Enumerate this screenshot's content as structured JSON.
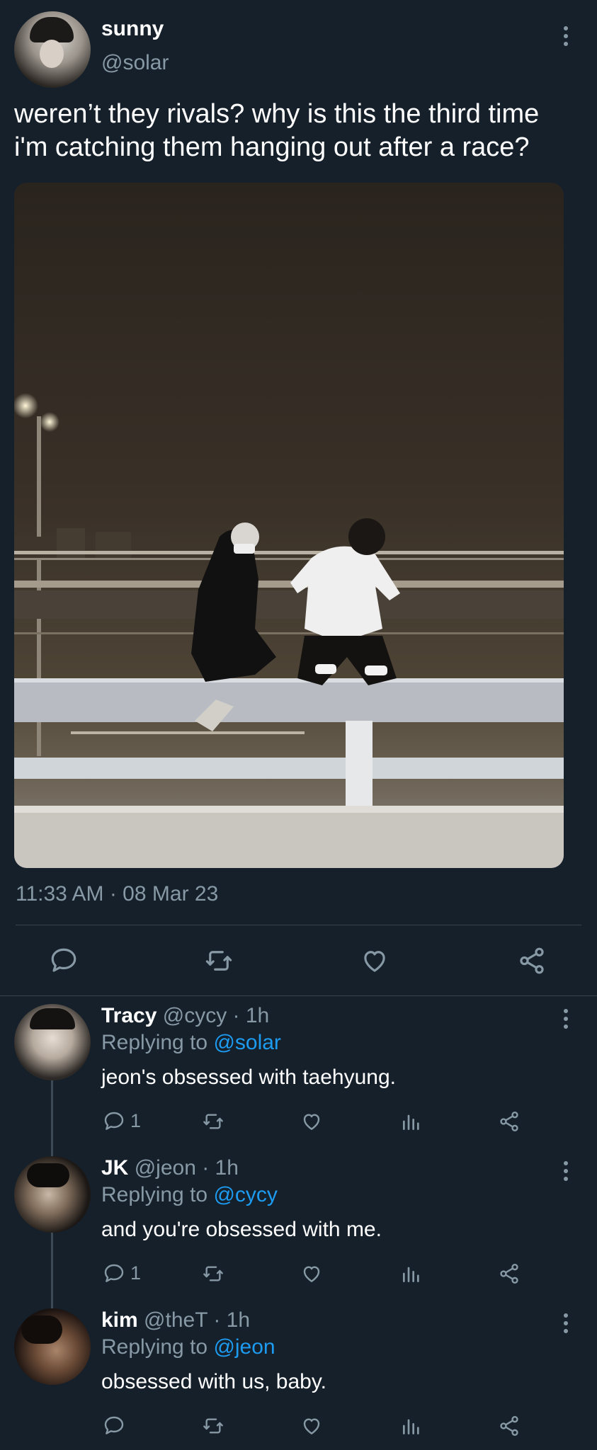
{
  "tweet": {
    "display_name": "sunny",
    "handle": "@solar",
    "text_line1": "weren’t they rivals? why is this the third time",
    "text_line2": "i'm catching them hanging out after a race?",
    "timestamp": "11:33 AM · 08 Mar 23"
  },
  "icons": {
    "reply": "reply-icon",
    "retweet": "retweet-icon",
    "like": "heart-icon",
    "views": "views-icon",
    "share": "share-icon",
    "more": "more-vertical-icon"
  },
  "replies": [
    {
      "display_name": "Tracy",
      "meta": "@cycy · 1h",
      "replying_prefix": "Replying to",
      "replying_to": "@solar",
      "text": "jeon's obsessed with taehyung.",
      "reply_count": "1"
    },
    {
      "display_name": "JK",
      "meta": "@jeon · 1h",
      "replying_prefix": "Replying to",
      "replying_to": "@cycy",
      "text": "and you're obsessed with me.",
      "reply_count": "1"
    },
    {
      "display_name": "kim",
      "meta": "@theT · 1h",
      "replying_prefix": "Replying to",
      "replying_to": "@jeon",
      "text": "obsessed with us, baby.",
      "reply_count": ""
    }
  ],
  "colors": {
    "background": "#15202b",
    "muted": "#8899a6",
    "link": "#1d9bf0",
    "divider": "#38444d"
  }
}
